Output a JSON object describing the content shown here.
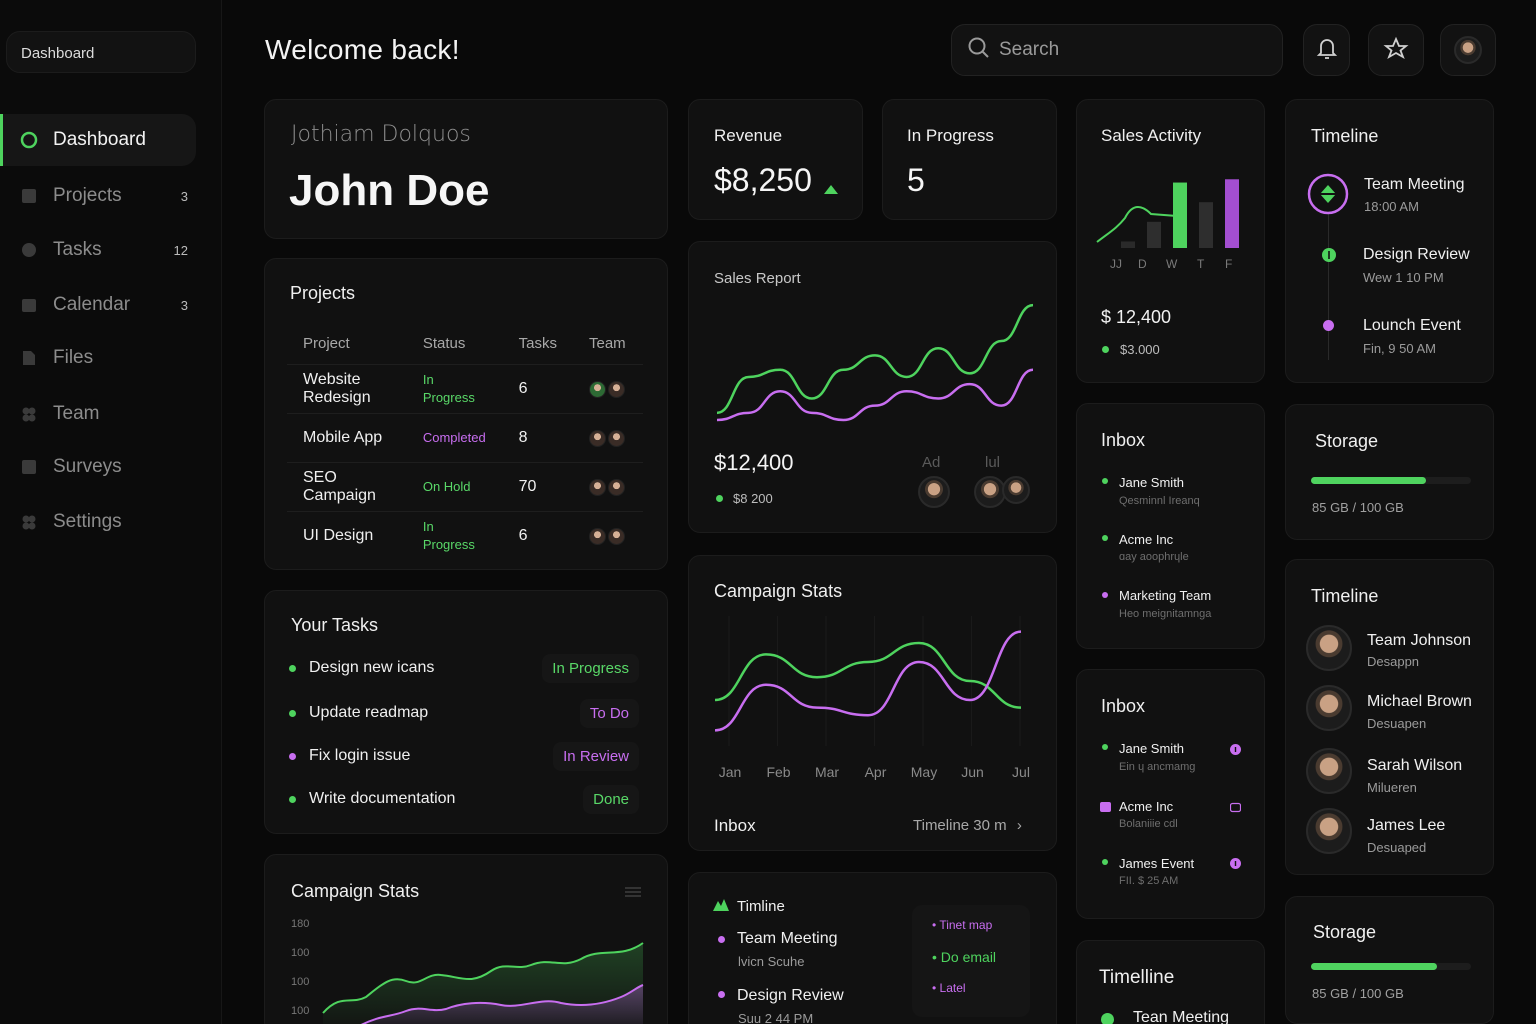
{
  "sidebar": {
    "brand": "Dashboard",
    "items": [
      {
        "label": "Dashboard",
        "icon": "chat-bubble-icon",
        "badge": ""
      },
      {
        "label": "Projects",
        "icon": "folder-icon",
        "badge": "3"
      },
      {
        "label": "Tasks",
        "icon": "check-circle-icon",
        "badge": "12"
      },
      {
        "label": "Calendar",
        "icon": "calendar-icon",
        "badge": "3"
      },
      {
        "label": "Files",
        "icon": "file-icon",
        "badge": ""
      },
      {
        "label": "Team",
        "icon": "team-icon",
        "badge": ""
      },
      {
        "label": "Surveys",
        "icon": "survey-icon",
        "badge": ""
      },
      {
        "label": "Settings",
        "icon": "gear-icon",
        "badge": ""
      }
    ]
  },
  "header": {
    "title": "Welcome back!",
    "search_placeholder": "Search"
  },
  "profile": {
    "subtitle": "Jothiam Dolquos",
    "name": "John Doe"
  },
  "projects": {
    "title": "Projects",
    "columns": [
      "Project",
      "Status",
      "Tasks",
      "Team"
    ],
    "rows": [
      {
        "name": "Website Redesign",
        "status": "In Progress",
        "tasks": "6"
      },
      {
        "name": "Mobile App",
        "status": "Completed",
        "tasks": "8"
      },
      {
        "name": "SEO Campaign",
        "status": "On Hold",
        "tasks": "70"
      },
      {
        "name": "UI Design",
        "status": "In Progress",
        "tasks": "6"
      }
    ]
  },
  "tasks": {
    "title": "Your Tasks",
    "items": [
      {
        "label": "Design new icans",
        "status": "In Progress"
      },
      {
        "label": "Update readmap",
        "status": "To Do"
      },
      {
        "label": "Fix login issue",
        "status": "In Review"
      },
      {
        "label": "Write documentation",
        "status": "Done"
      }
    ]
  },
  "campaign_left": {
    "title": "Campaign Stats",
    "y_ticks": [
      "180",
      "100",
      "100",
      "100"
    ]
  },
  "revenue": {
    "label": "Revenue",
    "value": "$8,250"
  },
  "in_progress": {
    "label": "In Progress",
    "value": "5"
  },
  "sales_report": {
    "title": "Sales Report",
    "value": "$12,400",
    "sub_value": "$8 200",
    "col_labels": [
      "Ad",
      "lul"
    ]
  },
  "campaign_mid": {
    "title": "Campaign Stats",
    "footer_left": "Inbox",
    "footer_right": "Timeline 30 m",
    "chevron": "›"
  },
  "timline_card": {
    "title": "Timline",
    "items": [
      {
        "title": "Team Meeting",
        "sub": "lvicn Scuhe"
      },
      {
        "title": "Design Review",
        "sub": "Suu 2 44 PM"
      }
    ],
    "side_items": [
      "Tinet map",
      "Do email",
      "Latel"
    ]
  },
  "sales_activity": {
    "title": "Sales Activity",
    "day_labels": [
      "JJ",
      "D",
      "W",
      "T",
      "F"
    ],
    "value": "$ 12,400",
    "sub_value": "$3.000"
  },
  "inbox_1": {
    "title": "Inbox",
    "items": [
      {
        "name": "Jane Smith",
        "sub": "Qesminnl Ireanq"
      },
      {
        "name": "Acme Inc",
        "sub": "ɑay aoophrɥle"
      },
      {
        "name": "Marketing Team",
        "sub": "Heo meignitamnga"
      }
    ]
  },
  "inbox_2": {
    "title": "Inbox",
    "items": [
      {
        "name": "Jane Smith",
        "sub": "Ein ɥ ancmamg"
      },
      {
        "name": "Acme Inc",
        "sub": "Bolaniiie cdl"
      },
      {
        "name": "James Event",
        "sub": "FII. $ 25 AM"
      }
    ]
  },
  "timeline_bottom_mid": {
    "title": "Timelline",
    "item": "Tean Meeting"
  },
  "timeline_top": {
    "title": "Timeline",
    "items": [
      {
        "title": "Team Meeting",
        "sub": "18:00 AM"
      },
      {
        "title": "Design Review",
        "sub": "Wew 1 10 PM"
      },
      {
        "title": "Lounch Event",
        "sub": "Fin, 9 50 AM"
      }
    ]
  },
  "storage_1": {
    "title": "Storage",
    "label": "85 GB / 100 GB",
    "fraction": 0.72
  },
  "team_timeline": {
    "title": "Timeline",
    "people": [
      {
        "name": "Team Johnson",
        "role": "Desappn"
      },
      {
        "name": "Michael Brown",
        "role": "Desuapen"
      },
      {
        "name": "Sarah Wilson",
        "role": "Milueren"
      },
      {
        "name": "James Lee",
        "role": "Desuaped"
      }
    ]
  },
  "storage_2": {
    "title": "Storage",
    "label": "85 GB / 100 GB",
    "fraction": 0.79
  },
  "colors": {
    "accent_green": "#4ed35e",
    "accent_purple": "#c86ef0",
    "background": "#090909",
    "card": "#111111"
  },
  "chart_data": [
    {
      "type": "line",
      "title": "Sales Report",
      "series": [
        {
          "values": [
            2,
            12,
            14,
            6,
            14,
            18,
            12,
            20,
            13,
            22,
            32
          ]
        },
        {
          "values": [
            0,
            2,
            8,
            2,
            0,
            4,
            8,
            6,
            10,
            4,
            14
          ]
        }
      ]
    },
    {
      "type": "line",
      "title": "Campaign Stats",
      "categories": [
        "Jan",
        "Feb",
        "Mar",
        "Apr",
        "May",
        "Jun",
        "Jul"
      ],
      "series": [
        {
          "values": [
            10,
            22,
            16,
            20,
            25,
            15,
            8
          ]
        },
        {
          "values": [
            2,
            14,
            8,
            6,
            20,
            10,
            28
          ]
        }
      ]
    },
    {
      "type": "bar",
      "title": "Sales Activity",
      "categories": [
        "JJ",
        "D",
        "W",
        "T",
        "F"
      ],
      "values": [
        2,
        8,
        20,
        14,
        21
      ]
    }
  ]
}
